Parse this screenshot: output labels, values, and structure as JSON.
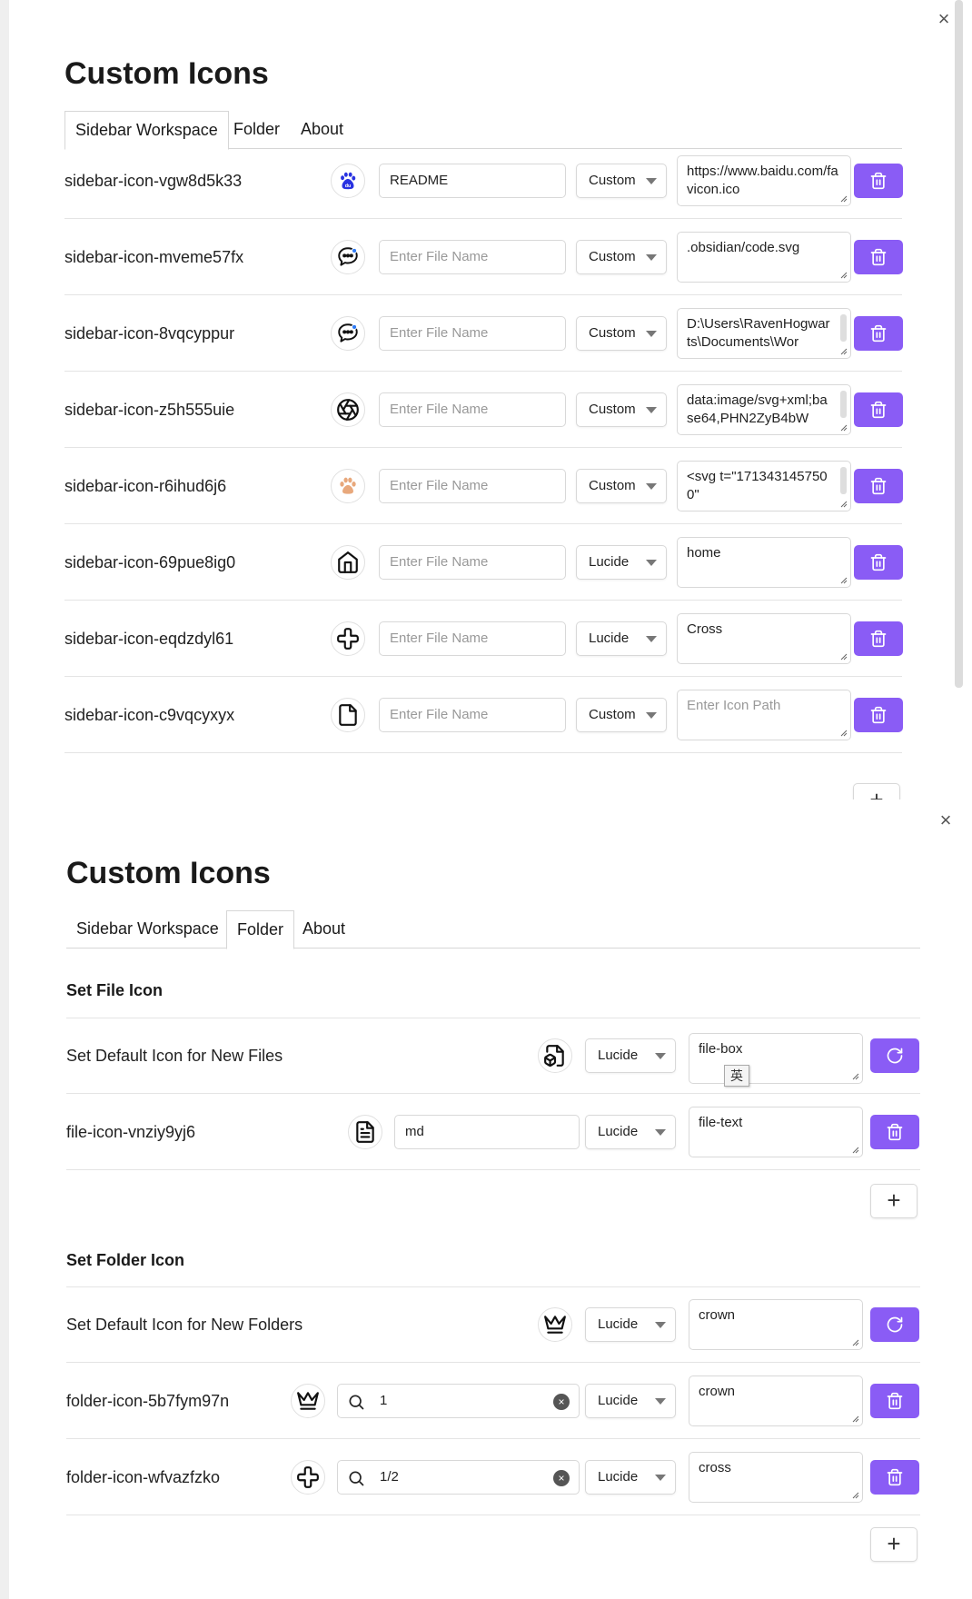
{
  "panel1": {
    "title": "Custom Icons",
    "tabs": [
      "Sidebar Workspace",
      "Folder",
      "About"
    ],
    "active_tab": "Sidebar Workspace",
    "rows": [
      {
        "label": "sidebar-icon-vgw8d5k33",
        "icon": "baidu-paw-icon",
        "file_name": "README",
        "file_placeholder": "",
        "type": "Custom",
        "path": "https://www.baidu.com/favicon.ico",
        "path_placeholder": ""
      },
      {
        "label": "sidebar-icon-mveme57fx",
        "icon": "chat-bubble-icon",
        "file_name": "",
        "file_placeholder": "Enter File Name",
        "type": "Custom",
        "path": ".obsidian/code.svg",
        "path_placeholder": ""
      },
      {
        "label": "sidebar-icon-8vqcyppur",
        "icon": "chat-bubble-icon",
        "file_name": "",
        "file_placeholder": "Enter File Name",
        "type": "Custom",
        "path": "D:\\Users\\RavenHogwarts\\Documents\\Wor",
        "path_placeholder": ""
      },
      {
        "label": "sidebar-icon-z5h555uie",
        "icon": "aperture-icon",
        "file_name": "",
        "file_placeholder": "Enter File Name",
        "type": "Custom",
        "path": "data:image/svg+xml;base64,PHN2ZyB4bW",
        "path_placeholder": ""
      },
      {
        "label": "sidebar-icon-r6ihud6j6",
        "icon": "paw-print-icon",
        "file_name": "",
        "file_placeholder": "Enter File Name",
        "type": "Custom",
        "path": "<svg t=\"1713431457500\"",
        "path_placeholder": ""
      },
      {
        "label": "sidebar-icon-69pue8ig0",
        "icon": "home-icon",
        "file_name": "",
        "file_placeholder": "Enter File Name",
        "type": "Lucide",
        "path": "home",
        "path_placeholder": ""
      },
      {
        "label": "sidebar-icon-eqdzdyl61",
        "icon": "cross-icon",
        "file_name": "",
        "file_placeholder": "Enter File Name",
        "type": "Lucide",
        "path": "Cross",
        "path_placeholder": ""
      },
      {
        "label": "sidebar-icon-c9vqcyxyx",
        "icon": "file-icon",
        "file_name": "",
        "file_placeholder": "Enter File Name",
        "type": "Custom",
        "path": "",
        "path_placeholder": "Enter Icon Path"
      }
    ],
    "add_label": "+"
  },
  "panel2": {
    "title": "Custom Icons",
    "tabs": [
      "Sidebar Workspace",
      "Folder",
      "About"
    ],
    "active_tab": "Folder",
    "file_section": {
      "heading": "Set File Icon",
      "default_row": {
        "label": "Set Default Icon for New Files",
        "icon": "file-box-icon",
        "type": "Lucide",
        "path": "file-box"
      },
      "ime_indicator": "英",
      "rows": [
        {
          "label": "file-icon-vnziy9yj6",
          "icon": "file-text-icon",
          "file_name": "md",
          "type": "Lucide",
          "path": "file-text"
        }
      ],
      "add_label": "+"
    },
    "folder_section": {
      "heading": "Set Folder Icon",
      "default_row": {
        "label": "Set Default Icon for New Folders",
        "icon": "crown-icon",
        "type": "Lucide",
        "path": "crown"
      },
      "rows": [
        {
          "label": "folder-icon-5b7fym97n",
          "icon": "crown-icon",
          "search": "1",
          "type": "Lucide",
          "path": "crown"
        },
        {
          "label": "folder-icon-wfvazfzko",
          "icon": "cross-icon",
          "search": "1/2",
          "type": "Lucide",
          "path": "cross"
        }
      ],
      "add_label": "+"
    }
  },
  "colors": {
    "accent": "#8a5cf5",
    "baidu_blue": "#2932e1",
    "paw_orange": "#e8a87c"
  }
}
